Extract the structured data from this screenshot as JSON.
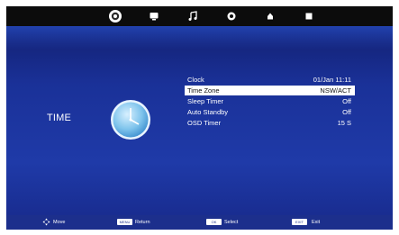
{
  "section": {
    "title": "TIME"
  },
  "menu": {
    "items": [
      {
        "label": "Clock",
        "value": "01/Jan 11:11",
        "selected": false
      },
      {
        "label": "Time Zone",
        "value": "NSW/ACT",
        "selected": true
      },
      {
        "label": "Sleep Timer",
        "value": "Off",
        "selected": false
      },
      {
        "label": "Auto Standby",
        "value": "Off",
        "selected": false
      },
      {
        "label": "OSD Timer",
        "value": "15 S",
        "selected": false
      }
    ]
  },
  "footer": {
    "move_label": "Move",
    "return_key": "MENU",
    "return_label": "Return",
    "select_key": "OK",
    "select_label": "Select",
    "exit_key": "EXIT",
    "exit_label": "Exit"
  },
  "tabs": [
    {
      "icon": "gear-icon",
      "active": true
    },
    {
      "icon": "picture-icon",
      "active": false
    },
    {
      "icon": "music-note-icon",
      "active": false
    },
    {
      "icon": "clock-icon",
      "active": false
    },
    {
      "icon": "lock-icon",
      "active": false
    },
    {
      "icon": "setup-icon",
      "active": false
    }
  ],
  "colors": {
    "background": "#1f3aa8",
    "topbar": "#0c0c0c",
    "selected_row": "#ffffff",
    "footer": "#1c2f8c"
  }
}
